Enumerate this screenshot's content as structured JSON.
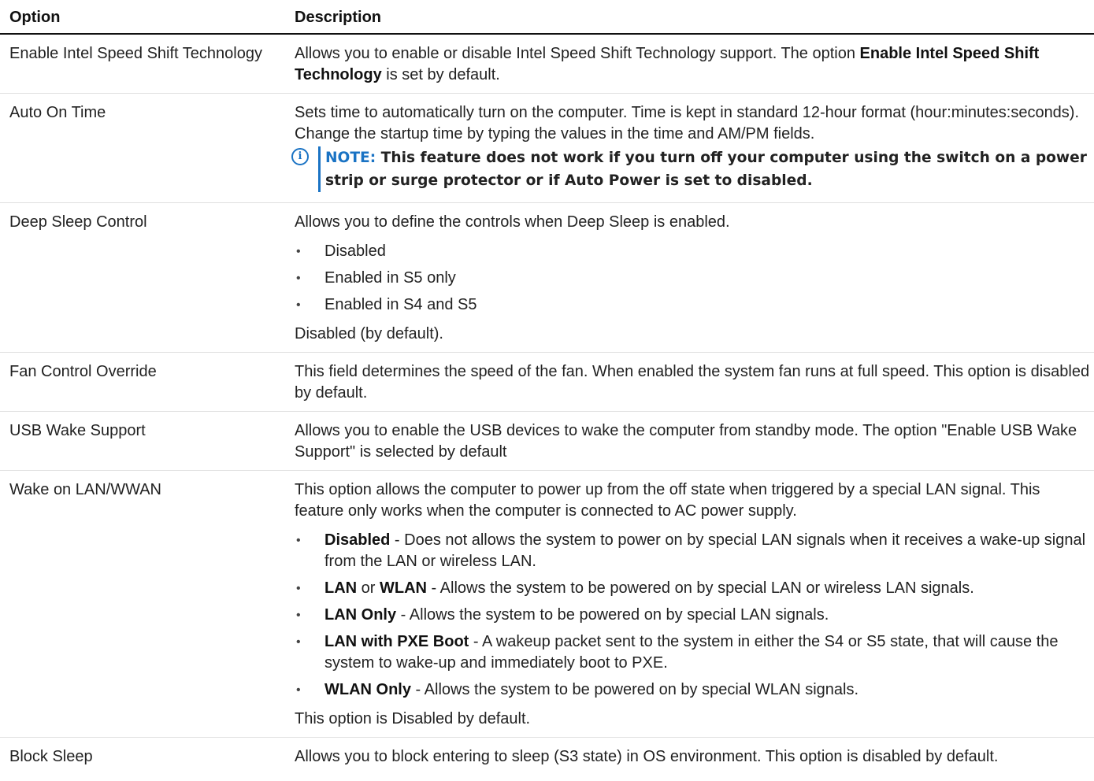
{
  "header": {
    "option": "Option",
    "description": "Description"
  },
  "rows": [
    {
      "option": "Enable Intel Speed Shift Technology",
      "desc_pre": "Allows you to enable or disable Intel Speed Shift Technology support. The option ",
      "desc_bold": "Enable Intel Speed Shift Technology",
      "desc_post": " is set by default."
    },
    {
      "option": "Auto On Time",
      "desc": "Sets time to automatically turn on the computer. Time is kept in standard 12-hour format (hour:minutes:seconds). Change the startup time by typing the values in the time and AM/PM fields.",
      "note_icon": "info-icon",
      "note_label": "NOTE:",
      "note_text": " This feature does not work if you turn off your computer using the switch on a power strip or surge protector or if Auto Power is set to disabled."
    },
    {
      "option": "Deep Sleep Control",
      "desc": "Allows you to define the controls when Deep Sleep is enabled.",
      "items": [
        "Disabled",
        "Enabled in S5 only",
        "Enabled in S4 and S5"
      ],
      "after": "Disabled (by default)."
    },
    {
      "option": "Fan Control Override",
      "desc": "This field determines the speed of the fan. When enabled the system fan runs at full speed. This option is disabled by default."
    },
    {
      "option": "USB Wake Support",
      "desc": "Allows you to enable the USB devices to wake the computer from standby mode. The option \"Enable USB Wake Support\" is selected by default"
    },
    {
      "option": "Wake on LAN/WWAN",
      "desc": "This option allows the computer to power up from the off state when triggered by a special LAN signal. This feature only works when the computer is connected to AC power supply.",
      "items": [
        {
          "b1": "Disabled",
          "t": " - Does not allows the system to power on by special LAN signals when it receives a wake-up signal from the LAN or wireless LAN."
        },
        {
          "b1": "LAN",
          "mid": " or ",
          "b2": "WLAN",
          "t": " - Allows the system to be powered on by special LAN or wireless LAN signals."
        },
        {
          "b1": "LAN Only",
          "t": " - Allows the system to be powered on by special LAN signals."
        },
        {
          "b1": "LAN with PXE Boot",
          "t": " - A wakeup packet sent to the system in either the S4 or S5 state, that will cause the system to wake-up and immediately boot to PXE."
        },
        {
          "b1": "WLAN Only",
          "t": " - Allows the system to be powered on by special WLAN signals."
        }
      ],
      "after": "This option is Disabled by default."
    },
    {
      "option": "Block Sleep",
      "desc": "Allows you to block entering to sleep (S3 state) in OS environment. This option is disabled by default."
    }
  ],
  "bullet_glyph": "•"
}
